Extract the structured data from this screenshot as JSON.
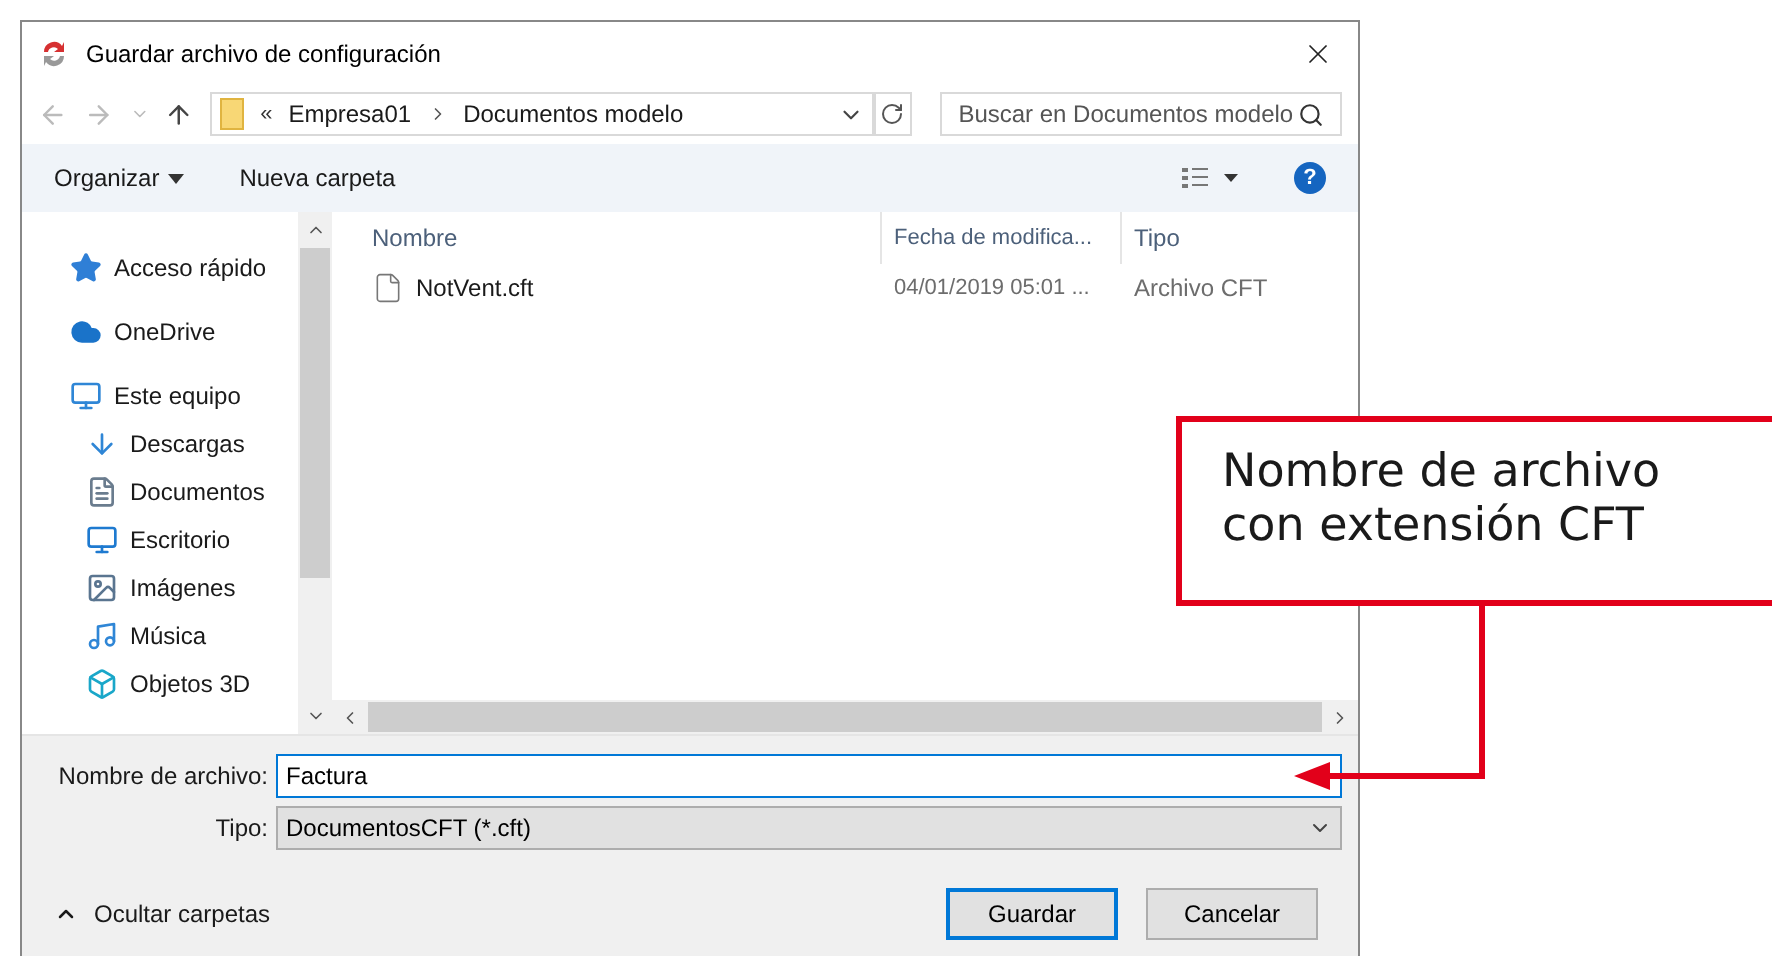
{
  "window": {
    "title": "Guardar archivo de configuración"
  },
  "address": {
    "overflow": "«",
    "crumbs": [
      "Empresa01",
      "Documentos modelo"
    ]
  },
  "search": {
    "placeholder": "Buscar en Documentos modelo"
  },
  "toolbar": {
    "organize": "Organizar",
    "new_folder": "Nueva carpeta",
    "help": "?"
  },
  "nav": [
    {
      "label": "Acceso rápido",
      "kind": "star"
    },
    {
      "label": "OneDrive",
      "kind": "cloud"
    },
    {
      "label": "Este equipo",
      "kind": "pc",
      "children": [
        {
          "label": "Descargas",
          "kind": "download"
        },
        {
          "label": "Documentos",
          "kind": "doc"
        },
        {
          "label": "Escritorio",
          "kind": "desktop"
        },
        {
          "label": "Imágenes",
          "kind": "image"
        },
        {
          "label": "Música",
          "kind": "music"
        },
        {
          "label": "Objetos 3D",
          "kind": "cube"
        }
      ]
    }
  ],
  "table": {
    "columns": [
      "Nombre",
      "Fecha de modifica...",
      "Tipo"
    ],
    "rows": [
      [
        "NotVent.cft",
        "04/01/2019 05:01 ...",
        "Archivo CFT"
      ]
    ]
  },
  "filename": {
    "label": "Nombre de archivo:",
    "value": "Factura"
  },
  "filetype": {
    "label": "Tipo:",
    "value": "DocumentosCFT (*.cft)"
  },
  "hide_folders": "Ocultar carpetas",
  "buttons": [
    {
      "label": "Guardar",
      "default": true
    },
    {
      "label": "Cancelar",
      "default": false
    }
  ],
  "callout": {
    "text": "Nombre de archivo con extensión CFT"
  }
}
